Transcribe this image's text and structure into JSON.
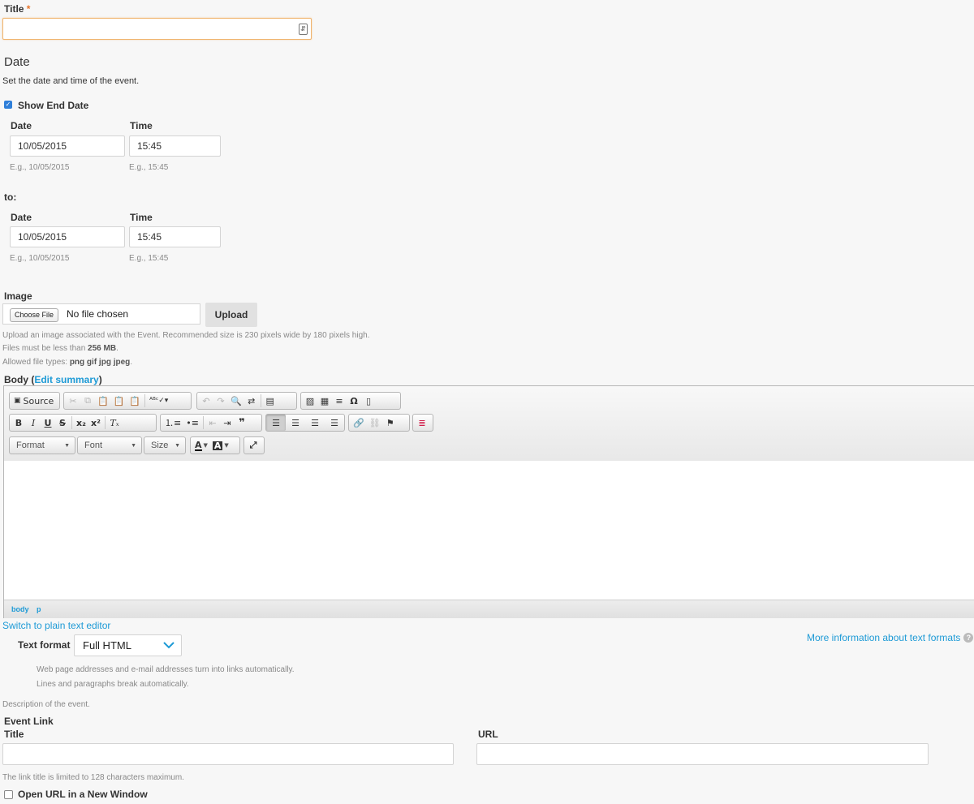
{
  "title_field": {
    "label": "Title",
    "required_mark": "*",
    "value": ""
  },
  "date_section": {
    "heading": "Date",
    "description": "Set the date and time of the event.",
    "show_end_date": {
      "label": "Show End Date",
      "checked": true
    },
    "start": {
      "date_label": "Date",
      "date_value": "10/05/2015",
      "date_hint": "E.g., 10/05/2015",
      "time_label": "Time",
      "time_value": "15:45",
      "time_hint": "E.g., 15:45"
    },
    "to_label": "to:",
    "end": {
      "date_label": "Date",
      "date_value": "10/05/2015",
      "date_hint": "E.g., 10/05/2015",
      "time_label": "Time",
      "time_value": "15:45",
      "time_hint": "E.g., 15:45"
    }
  },
  "image": {
    "label": "Image",
    "choose_button": "Choose File",
    "no_file": "No file chosen",
    "upload_button": "Upload",
    "help_line1": "Upload an image associated with the Event. Recommended size is 230 pixels wide by 180 pixels high.",
    "help_line2_prefix": "Files must be less than",
    "help_line2_size": "256 MB",
    "help_line2_suffix": ".",
    "help_line3_prefix": "Allowed file types:",
    "help_line3_types": "png gif jpg jpeg",
    "help_line3_suffix": "."
  },
  "body": {
    "label": "Body",
    "paren_open": "(",
    "edit_summary": "Edit summary",
    "paren_close": ")",
    "toolbar": {
      "source": "Source",
      "format": "Format",
      "font": "Font",
      "size": "Size"
    },
    "path": [
      "body",
      "p"
    ],
    "switch_link": "Switch to plain text editor"
  },
  "text_format": {
    "label": "Text format",
    "selected": "Full HTML",
    "more_info": "More information about text formats",
    "tips": [
      "Web page addresses and e-mail addresses turn into links automatically.",
      "Lines and paragraphs break automatically."
    ],
    "description": "Description of the event."
  },
  "event_link": {
    "heading": "Event Link",
    "title_label": "Title",
    "title_value": "",
    "url_label": "URL",
    "url_value": "",
    "title_hint": "The link title is limited to 128 characters maximum.",
    "new_window": {
      "label": "Open URL in a New Window",
      "checked": false
    }
  },
  "colors": {
    "accent_link": "#1d9ad6",
    "required": "#e8752a",
    "focus_border": "#f0b36b"
  },
  "icons": [
    "form-fill-icon",
    "checkbox-checked-icon",
    "dropdown-chevron-icon",
    "help-circle-icon"
  ]
}
